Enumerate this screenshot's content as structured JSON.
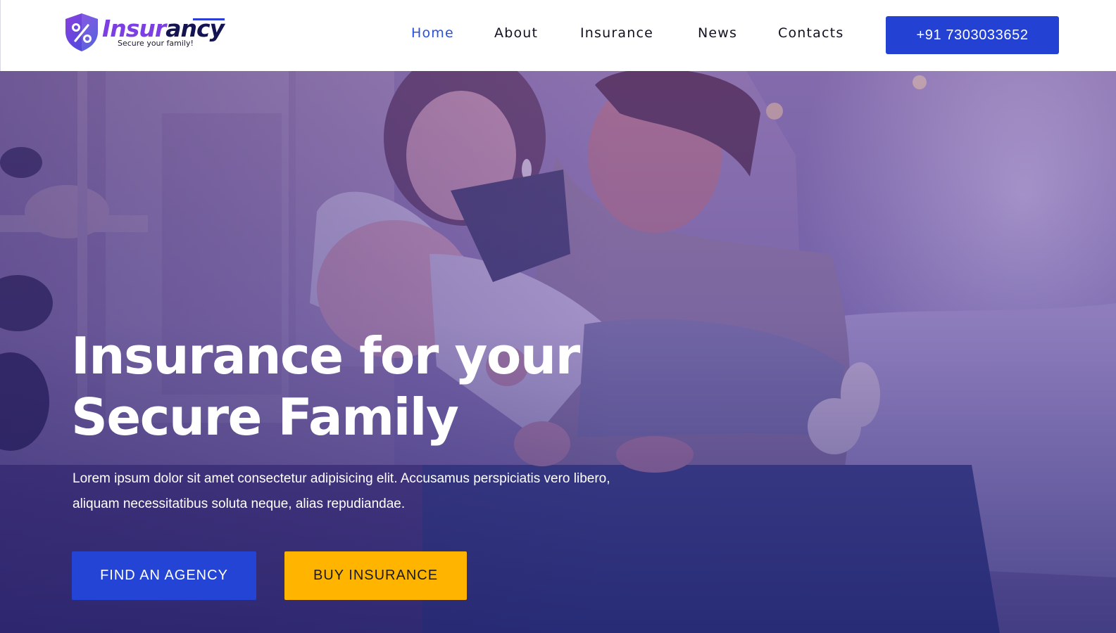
{
  "brand": {
    "name_part1": "Insur",
    "name_part2": "ancy",
    "tagline": "Secure your family!",
    "primary_color": "#2341d3",
    "accent_color": "#7b3fe4",
    "icon": "percent-shield-icon"
  },
  "nav": {
    "items": [
      {
        "label": "Home",
        "active": true
      },
      {
        "label": "About",
        "active": false
      },
      {
        "label": "Insurance",
        "active": false
      },
      {
        "label": "News",
        "active": false
      },
      {
        "label": "Contacts",
        "active": false
      }
    ],
    "phone_button": "+91 7303033652"
  },
  "hero": {
    "title_line1": "Insurance for your",
    "title_line2": "Secure Family",
    "text": "Lorem ipsum dolor sit amet consectetur adipisicing elit. Accusamus perspiciatis vero libero, aliquam necessitatibus soluta neque, alias repudiandae.",
    "primary_button": "FIND AN AGENCY",
    "secondary_button": "BUY INSURANCE",
    "secondary_color": "#ffb400"
  }
}
